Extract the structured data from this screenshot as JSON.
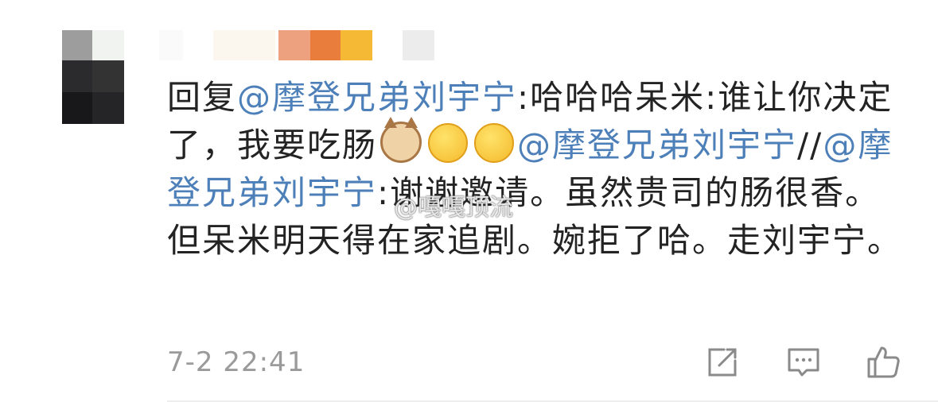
{
  "comment": {
    "prefix": "回复",
    "mention1": "@摩登兄弟刘宇宁",
    "text1": ":哈哈哈呆米:谁让你决定了，我要吃肠",
    "mention2": "@摩登兄弟刘宇宁",
    "sep": "//",
    "mention3": "@摩登兄弟刘宇宁",
    "text2": ":谢谢邀请。虽然贵司的肠很香。但呆米明天得在家追剧。婉拒了哈。走刘宇宁。",
    "emojis": [
      "cat-emoji-icon",
      "yawn-emoji-icon",
      "yawn-emoji-icon"
    ]
  },
  "watermark": "@嘎嘎顶流",
  "meta": {
    "time": "7-2 22:41"
  },
  "actions": [
    "share-icon",
    "comment-icon",
    "like-icon"
  ],
  "colors": {
    "mention": "#4d7fb8",
    "text": "#232323",
    "meta": "#9a9a9a"
  }
}
